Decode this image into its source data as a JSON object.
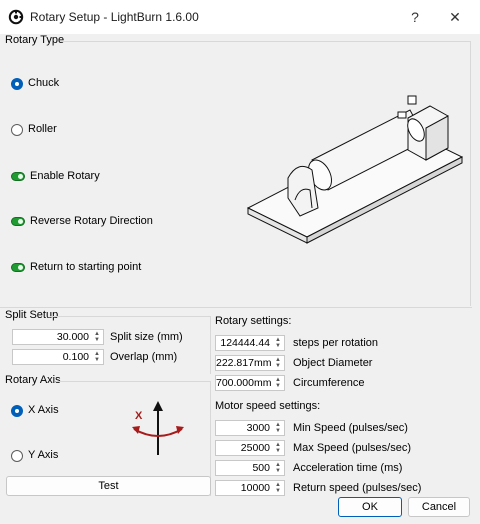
{
  "window": {
    "title": "Rotary Setup - LightBurn 1.6.00",
    "help_glyph": "?",
    "close_glyph": "✕"
  },
  "rotary_type": {
    "title": "Rotary Type",
    "chuck_label": "Chuck",
    "roller_label": "Roller",
    "selected": "Chuck",
    "enable_rotary_label": "Enable Rotary",
    "enable_rotary_on": true,
    "reverse_label": "Reverse Rotary Direction",
    "reverse_on": true,
    "return_label": "Return to starting point",
    "return_on": true
  },
  "split_setup": {
    "title": "Split Setup",
    "split_size_value": "30.000",
    "split_size_label": "Split size (mm)",
    "overlap_value": "0.100",
    "overlap_label": "Overlap (mm)"
  },
  "rotary_axis": {
    "title": "Rotary Axis",
    "x_label": "X Axis",
    "y_label": "Y Axis",
    "selected": "X Axis",
    "axis_glyph_letter": "X",
    "test_label": "Test"
  },
  "rotary_settings": {
    "title": "Rotary settings:",
    "steps_value": "124444.44",
    "steps_label": "steps per rotation",
    "diameter_value": "222.817mm",
    "diameter_label": "Object Diameter",
    "circumference_value": "700.000mm",
    "circumference_label": "Circumference"
  },
  "motor_speed": {
    "title": "Motor speed settings:",
    "min_value": "3000",
    "min_label": "Min Speed (pulses/sec)",
    "max_value": "25000",
    "max_label": "Max Speed (pulses/sec)",
    "accel_value": "500",
    "accel_label": "Acceleration time (ms)",
    "return_value": "10000",
    "return_label": "Return speed (pulses/sec)"
  },
  "buttons": {
    "ok": "OK",
    "cancel": "Cancel"
  },
  "colors": {
    "accent": "#005fb8",
    "toggle_on": "#1f9b32",
    "window_bg": "#f0f0f0"
  }
}
